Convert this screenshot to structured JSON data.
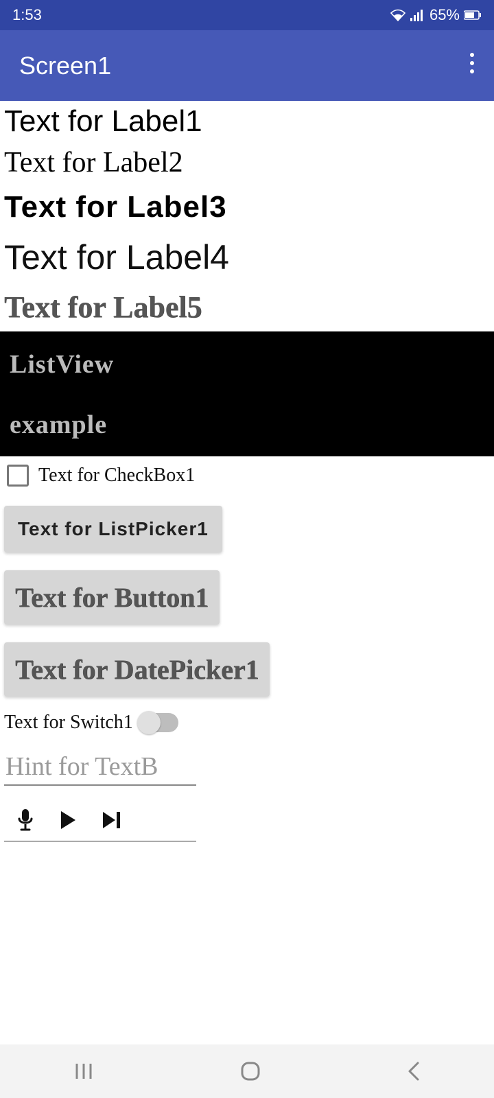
{
  "status": {
    "time": "1:53",
    "battery": "65%"
  },
  "appbar": {
    "title": "Screen1"
  },
  "labels": {
    "l1": "Text for Label1",
    "l2": "Text for Label2",
    "l3": "Text for Label3",
    "l4": "Text for Label4",
    "l5": "Text for Label5"
  },
  "listview": {
    "items": [
      "ListView",
      "example"
    ]
  },
  "checkbox": {
    "label": "Text for CheckBox1",
    "checked": false
  },
  "listpicker": {
    "label": "Text for ListPicker1"
  },
  "button1": {
    "label": "Text for Button1"
  },
  "datepicker": {
    "label": "Text for DatePicker1"
  },
  "switch1": {
    "label": "Text for Switch1",
    "on": false
  },
  "textbox": {
    "hint": "Hint for TextB",
    "value": ""
  }
}
